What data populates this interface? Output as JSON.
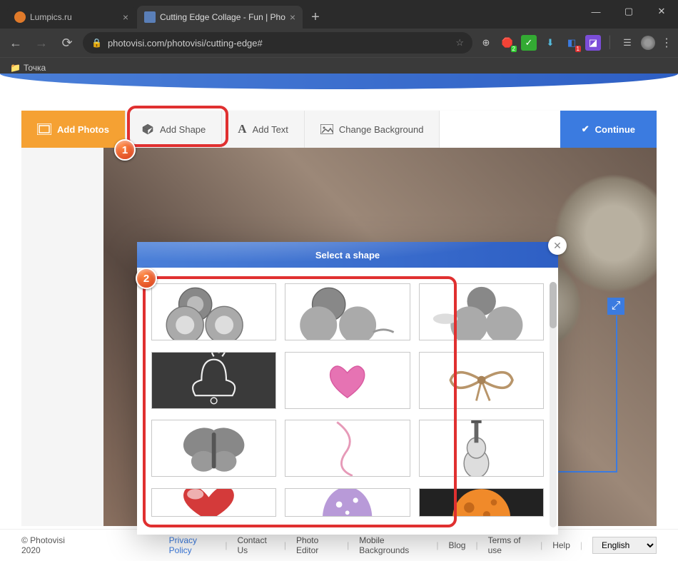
{
  "chrome": {
    "tabs": [
      {
        "title": "Lumpics.ru",
        "favicon": "#e07a2a",
        "active": false
      },
      {
        "title": "Cutting Edge Collage - Fun | Pho",
        "favicon": "#5a7fb8",
        "active": true
      }
    ],
    "url": "photovisi.com/photovisi/cutting-edge#",
    "bookmark": "Точка"
  },
  "toolbar": {
    "add_photos": "Add Photos",
    "add_shape": "Add Shape",
    "add_text": "Add Text",
    "change_bg": "Change Background",
    "continue": "Continue"
  },
  "dialog": {
    "title": "Select a shape"
  },
  "footer": {
    "copyright": "© Photovisi 2020",
    "privacy": "Privacy Policy",
    "contact": "Contact Us",
    "editor": "Photo Editor",
    "mobile": "Mobile Backgrounds",
    "blog": "Blog",
    "terms": "Terms of use",
    "help": "Help",
    "lang": "English"
  },
  "callouts": {
    "one": "1",
    "two": "2"
  }
}
